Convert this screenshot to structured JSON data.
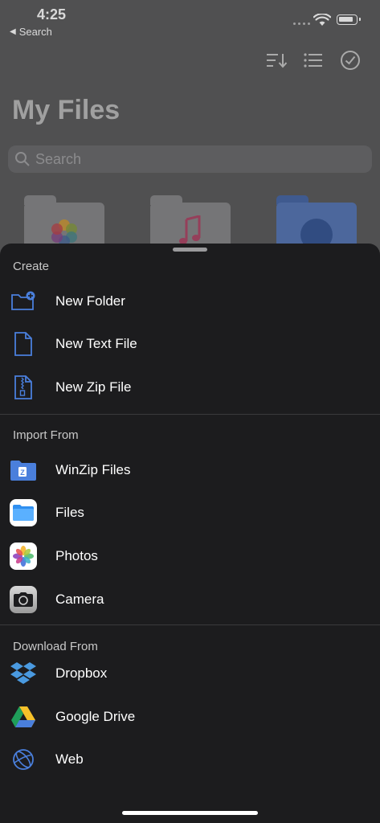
{
  "status_bar": {
    "time": "4:25",
    "back_label": "Search"
  },
  "header": {
    "title": "My Files"
  },
  "search": {
    "placeholder": "Search"
  },
  "colors": {
    "accent": "#4a7fdc",
    "sheet_bg": "#1c1c1e",
    "dim_bg": "#5f5f60"
  },
  "sheet": {
    "create": {
      "label": "Create",
      "items": [
        {
          "label": "New Folder",
          "icon": "new-folder-icon"
        },
        {
          "label": "New Text File",
          "icon": "text-file-icon"
        },
        {
          "label": "New Zip File",
          "icon": "zip-file-icon"
        }
      ]
    },
    "import": {
      "label": "Import From",
      "items": [
        {
          "label": "WinZip Files",
          "icon": "winzip-folder-icon"
        },
        {
          "label": "Files",
          "icon": "files-app-icon"
        },
        {
          "label": "Photos",
          "icon": "photos-app-icon"
        },
        {
          "label": "Camera",
          "icon": "camera-app-icon"
        }
      ]
    },
    "download": {
      "label": "Download From",
      "items": [
        {
          "label": "Dropbox",
          "icon": "dropbox-icon"
        },
        {
          "label": "Google Drive",
          "icon": "google-drive-icon"
        },
        {
          "label": "Web",
          "icon": "web-globe-icon"
        }
      ]
    }
  }
}
